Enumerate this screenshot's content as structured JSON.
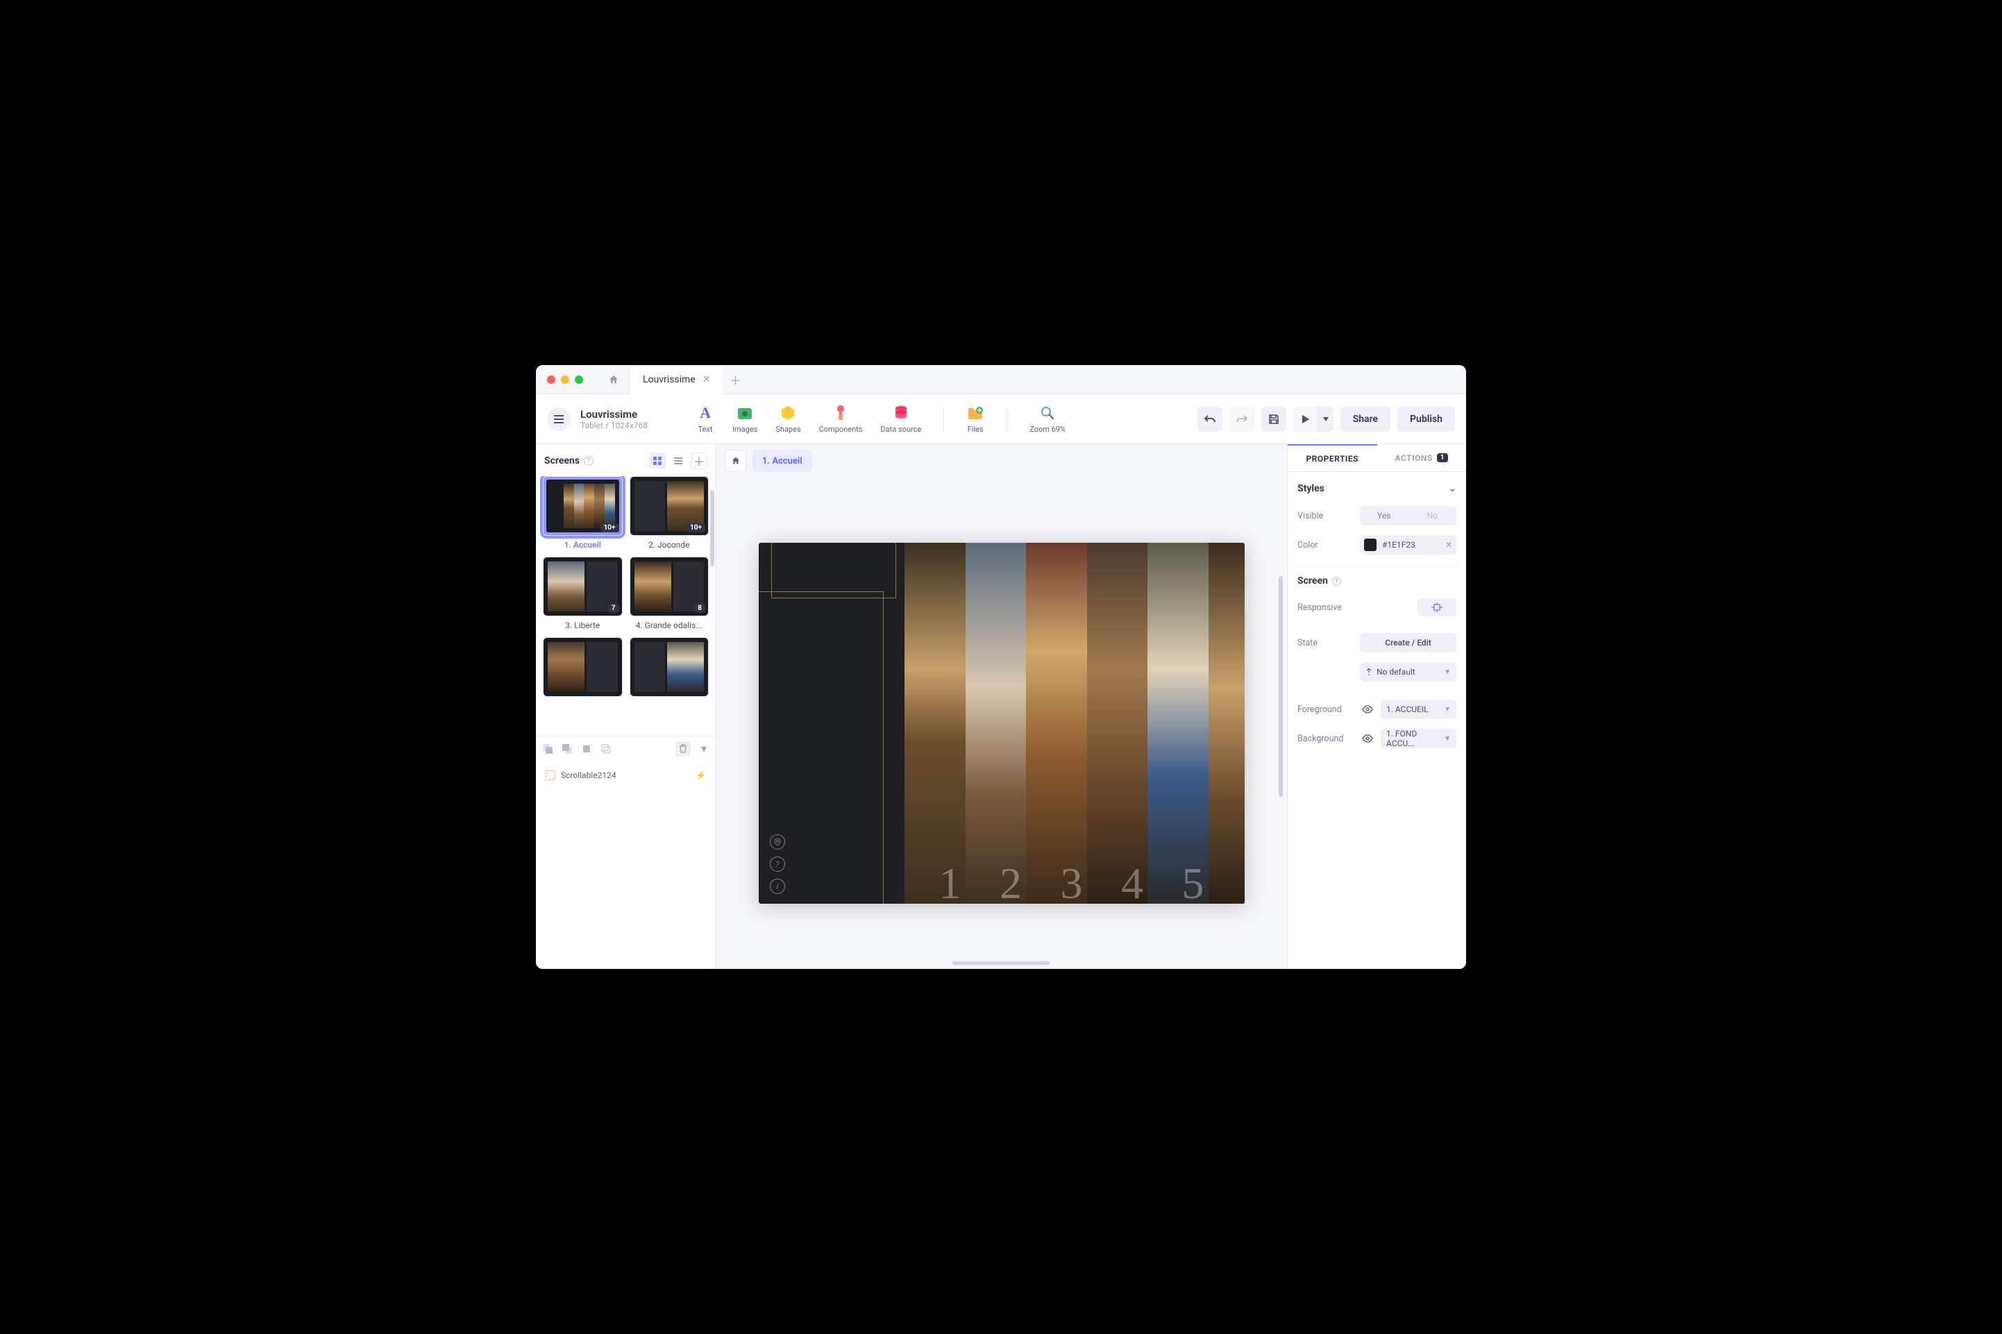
{
  "tab": {
    "title": "Louvrissime"
  },
  "project": {
    "title": "Louvrissime",
    "device": "Tablet / 1024x768"
  },
  "tools": {
    "text": "Text",
    "images": "Images",
    "shapes": "Shapes",
    "components": "Components",
    "datasource": "Data source",
    "files": "Files",
    "zoom": "Zoom 69%"
  },
  "toolbar": {
    "share": "Share",
    "publish": "Publish"
  },
  "left": {
    "title": "Screens",
    "screens": [
      {
        "name": "1. Accueil",
        "badge": "10+",
        "sel": true
      },
      {
        "name": "2. Joconde",
        "badge": "10+"
      },
      {
        "name": "3. Liberte",
        "badge": "7"
      },
      {
        "name": "4. Grande odalis...",
        "badge": "8"
      },
      {
        "name": "",
        "badge": ""
      },
      {
        "name": "",
        "badge": ""
      }
    ],
    "tree_item": "Scrollable2124"
  },
  "crumb": "1. Accueil",
  "panel": {
    "tab1": "PROPERTIES",
    "tab2": "ACTIONS",
    "tab2_count": "1",
    "styles": "Styles",
    "visible": "Visible",
    "yes": "Yes",
    "no": "No",
    "color_lbl": "Color",
    "color_val": "#1E1F23",
    "screen": "Screen",
    "responsive": "Responsive",
    "state": "State",
    "create_edit": "Create / Edit",
    "no_default": "No default",
    "foreground": "Foreground",
    "foreground_val": "1. ACCUEIL",
    "background": "Background",
    "background_val": "1. FOND ACCU..."
  },
  "canvas": {
    "numbers": [
      "1",
      "2",
      "3",
      "4",
      "5"
    ]
  }
}
